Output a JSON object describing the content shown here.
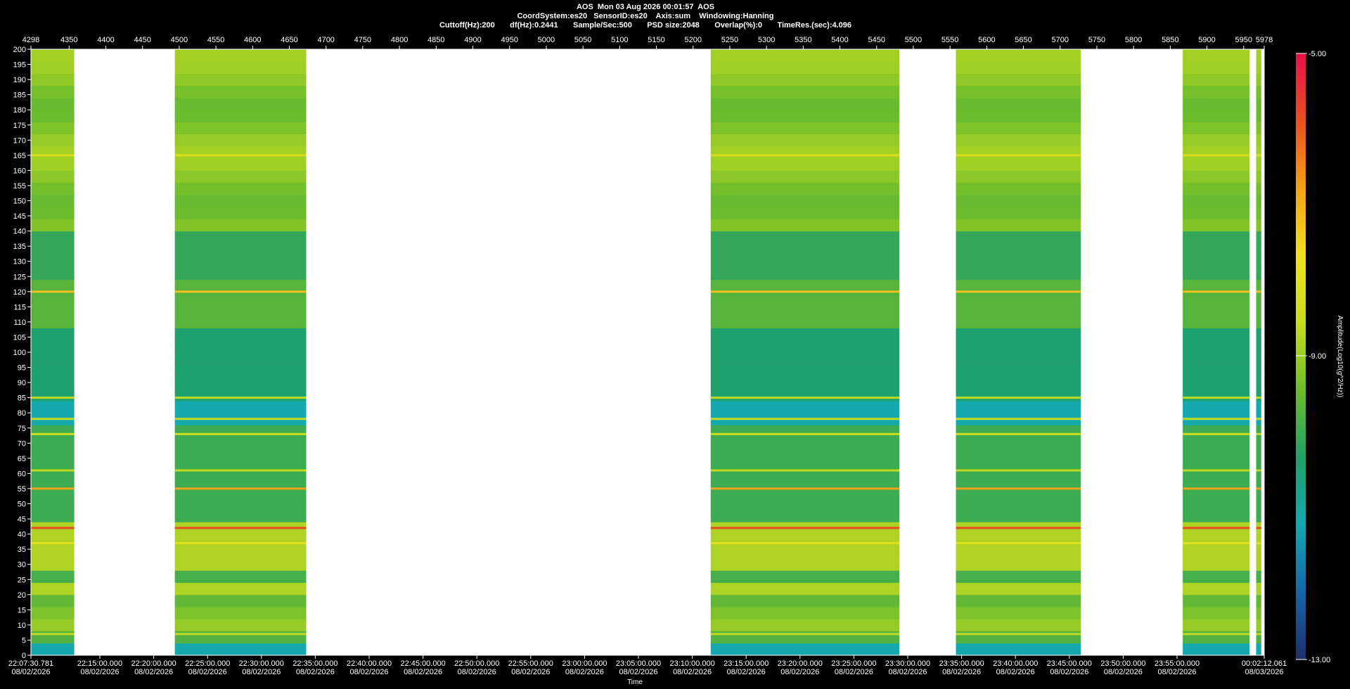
{
  "header": {
    "title": "AOS  Mon 03 Aug 2026 00:01:57  AOS",
    "line2": "CoordSystem:es20   SensorID:es20    Axis:sum    Windowing:Hanning",
    "line3": "Cuttoff(Hz):200       df(Hz):0.2441       Sample/Sec:500       PSD size:2048       Overlap(%):0       TimeRes.(sec):4.096"
  },
  "colors": {
    "background": "#000000",
    "axis": "#ffffff",
    "gap": "#ffffff",
    "colormap": [
      "#1e2f6b",
      "#1565a8",
      "#15a8b0",
      "#20a068",
      "#6cbc2c",
      "#c8dc20",
      "#f0e020",
      "#f4a018",
      "#e85020",
      "#e8104c"
    ]
  },
  "chart_data": {
    "type": "heatmap",
    "title": "AOS  Mon 03 Aug 2026 00:01:57  AOS",
    "xlabel": "Time",
    "ylabel": "",
    "x_top_ticks": [
      "4298",
      "4350",
      "4400",
      "4450",
      "4500",
      "4550",
      "4600",
      "4650",
      "4700",
      "4750",
      "4800",
      "4850",
      "4900",
      "4950",
      "5000",
      "5050",
      "5100",
      "5150",
      "5200",
      "5250",
      "5300",
      "5350",
      "5400",
      "5450",
      "5500",
      "5550",
      "5600",
      "5650",
      "5700",
      "5750",
      "5800",
      "5850",
      "5900",
      "5950",
      "5978"
    ],
    "x_bottom_ticks": [
      {
        "time": "22:07:30.781",
        "date": "08/02/2026"
      },
      {
        "time": "22:15:00.000",
        "date": "08/02/2026"
      },
      {
        "time": "22:20:00.000",
        "date": "08/02/2026"
      },
      {
        "time": "22:25:00.000",
        "date": "08/02/2026"
      },
      {
        "time": "22:30:00.000",
        "date": "08/02/2026"
      },
      {
        "time": "22:35:00.000",
        "date": "08/02/2026"
      },
      {
        "time": "22:40:00.000",
        "date": "08/02/2026"
      },
      {
        "time": "22:45:00.000",
        "date": "08/02/2026"
      },
      {
        "time": "22:50:00.000",
        "date": "08/02/2026"
      },
      {
        "time": "22:55:00.000",
        "date": "08/02/2026"
      },
      {
        "time": "23:00:00.000",
        "date": "08/02/2026"
      },
      {
        "time": "23:05:00.000",
        "date": "08/02/2026"
      },
      {
        "time": "23:10:00.000",
        "date": "08/02/2026"
      },
      {
        "time": "23:15:00.000",
        "date": "08/02/2026"
      },
      {
        "time": "23:20:00.000",
        "date": "08/02/2026"
      },
      {
        "time": "23:25:00.000",
        "date": "08/02/2026"
      },
      {
        "time": "23:30:00.000",
        "date": "08/02/2026"
      },
      {
        "time": "23:35:00.000",
        "date": "08/02/2026"
      },
      {
        "time": "23:40:00.000",
        "date": "08/02/2026"
      },
      {
        "time": "23:45:00.000",
        "date": "08/02/2026"
      },
      {
        "time": "23:50:00.000",
        "date": "08/02/2026"
      },
      {
        "time": "23:55:00.000",
        "date": "08/02/2026"
      },
      {
        "time": "00:02:12.061",
        "date": "08/03/2026"
      }
    ],
    "y_ticks": [
      0,
      5,
      10,
      15,
      20,
      25,
      30,
      35,
      40,
      45,
      50,
      55,
      60,
      65,
      70,
      75,
      80,
      85,
      90,
      95,
      100,
      105,
      110,
      115,
      120,
      125,
      130,
      135,
      140,
      145,
      150,
      155,
      160,
      165,
      170,
      175,
      180,
      185,
      190,
      195,
      200
    ],
    "ylim": [
      0,
      200
    ],
    "xlim": [
      4298,
      5978
    ],
    "data_segments": [
      [
        4298,
        4357
      ],
      [
        4494,
        4673
      ],
      [
        5224,
        5481
      ],
      [
        5558,
        5728
      ],
      [
        5867,
        5958
      ],
      [
        5967,
        5974
      ]
    ],
    "horizontal_lines_hz": [
      {
        "hz": 165,
        "level": -8.2
      },
      {
        "hz": 120,
        "level": -7.2
      },
      {
        "hz": 85,
        "level": -8.6
      },
      {
        "hz": 78,
        "level": -8.6
      },
      {
        "hz": 73,
        "level": -8.4
      },
      {
        "hz": 61,
        "level": -8.6
      },
      {
        "hz": 55,
        "level": -6.8
      },
      {
        "hz": 42,
        "level": -5.8
      },
      {
        "hz": 37,
        "level": -8.0
      },
      {
        "hz": 7,
        "level": -8.6
      }
    ],
    "colorbar": {
      "label": "Amplitude(Log10(g^2/Hz))",
      "ticks": [
        "-5.00",
        "-9.00",
        "-13.00"
      ],
      "range": [
        -13,
        -5
      ]
    }
  }
}
